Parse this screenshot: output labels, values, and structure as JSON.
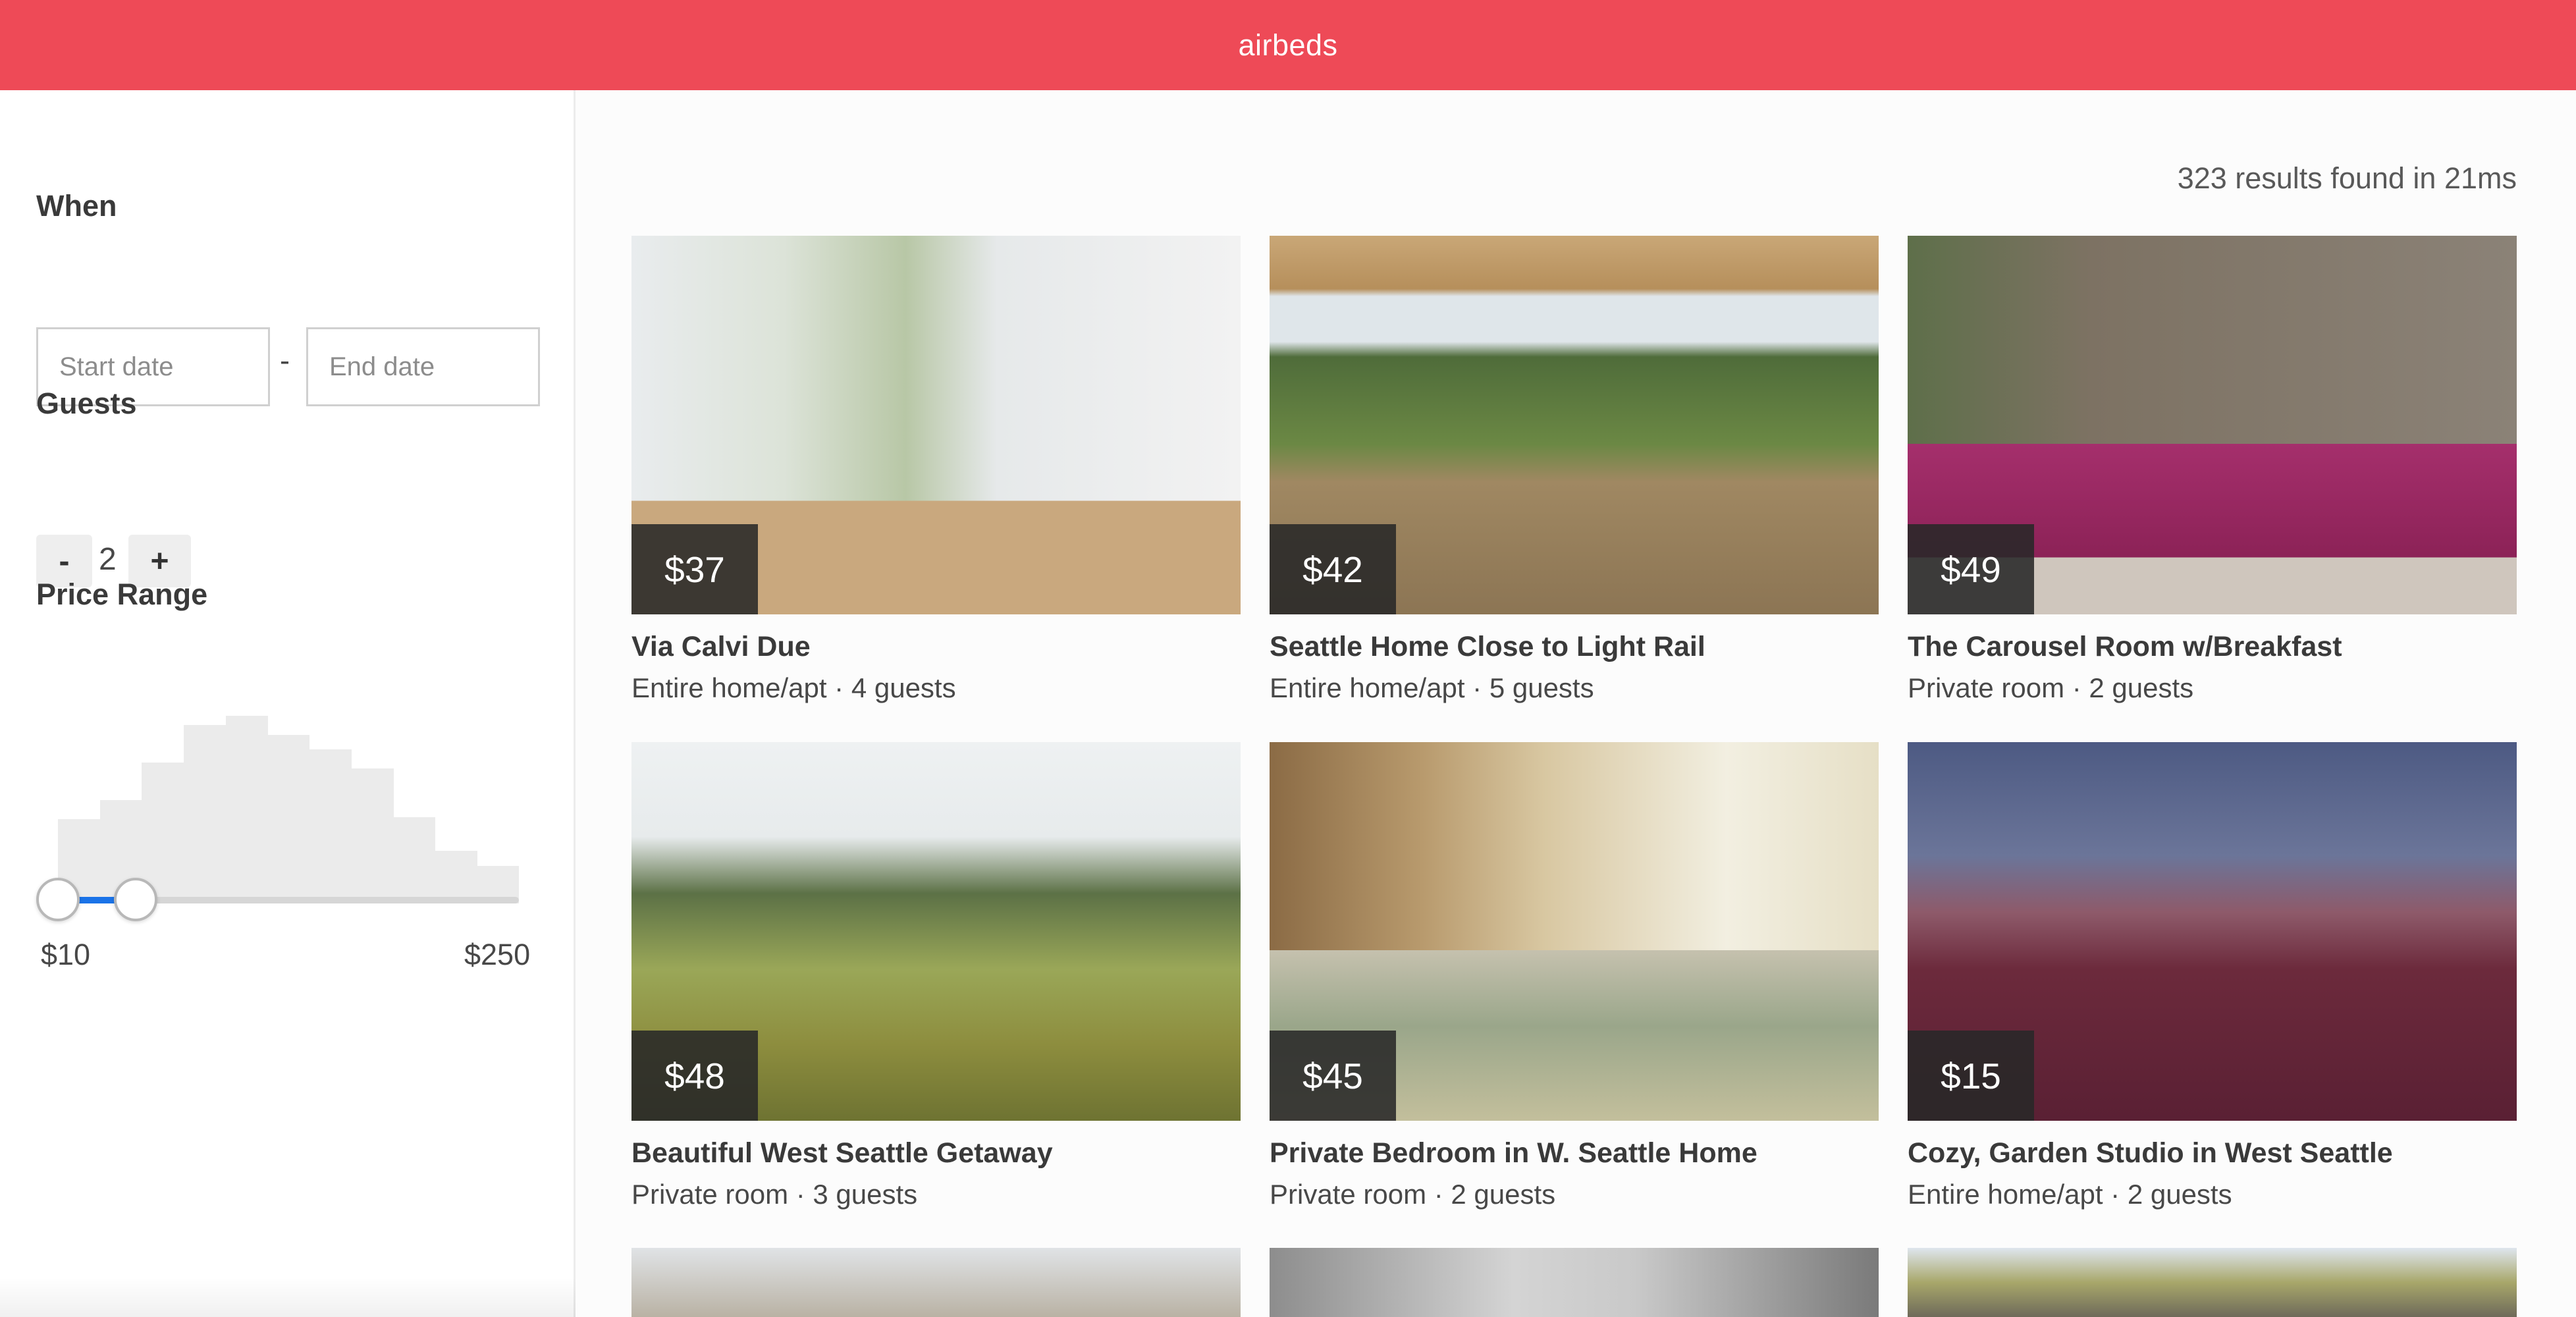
{
  "app": {
    "brand": "airbeds"
  },
  "colors": {
    "brand": "#ee4a57",
    "slider_accent": "#1a73e8"
  },
  "filters": {
    "when": {
      "title": "When",
      "start_placeholder": "Start date",
      "separator": "-",
      "end_placeholder": "End date"
    },
    "guests": {
      "title": "Guests",
      "minus_label": "-",
      "count": "2",
      "plus_label": "+"
    },
    "price_range": {
      "title": "Price Range",
      "min_label": "$10",
      "max_label": "$250",
      "histogram": [
        0.45,
        0.55,
        0.75,
        0.95,
        1.0,
        0.9,
        0.82,
        0.72,
        0.46,
        0.28,
        0.2
      ],
      "selected_low_fraction": 0.0,
      "selected_high_fraction": 0.17
    }
  },
  "results": {
    "summary": "323 results found in 21ms",
    "listings": [
      {
        "price": "$37",
        "title": "Via Calvi Due",
        "subtitle": "Entire home/apt · 4 guests",
        "photo": "living-room-photo"
      },
      {
        "price": "$42",
        "title": "Seattle Home Close to Light Rail",
        "subtitle": "Entire home/apt · 5 guests",
        "photo": "deck-patio-photo"
      },
      {
        "price": "$49",
        "title": "The Carousel Room w/Breakfast",
        "subtitle": "Private room · 2 guests",
        "photo": "bedroom-photo"
      },
      {
        "price": "$48",
        "title": "Beautiful West Seattle Getaway",
        "subtitle": "Private room · 3 guests",
        "photo": "backyard-photo"
      },
      {
        "price": "$45",
        "title": "Private Bedroom in W. Seattle Home",
        "subtitle": "Private room · 2 guests",
        "photo": "bedroom-photo"
      },
      {
        "price": "$15",
        "title": "Cozy, Garden Studio in West Seattle",
        "subtitle": "Entire home/apt · 2 guests",
        "photo": "garden-patio-photo"
      }
    ]
  }
}
